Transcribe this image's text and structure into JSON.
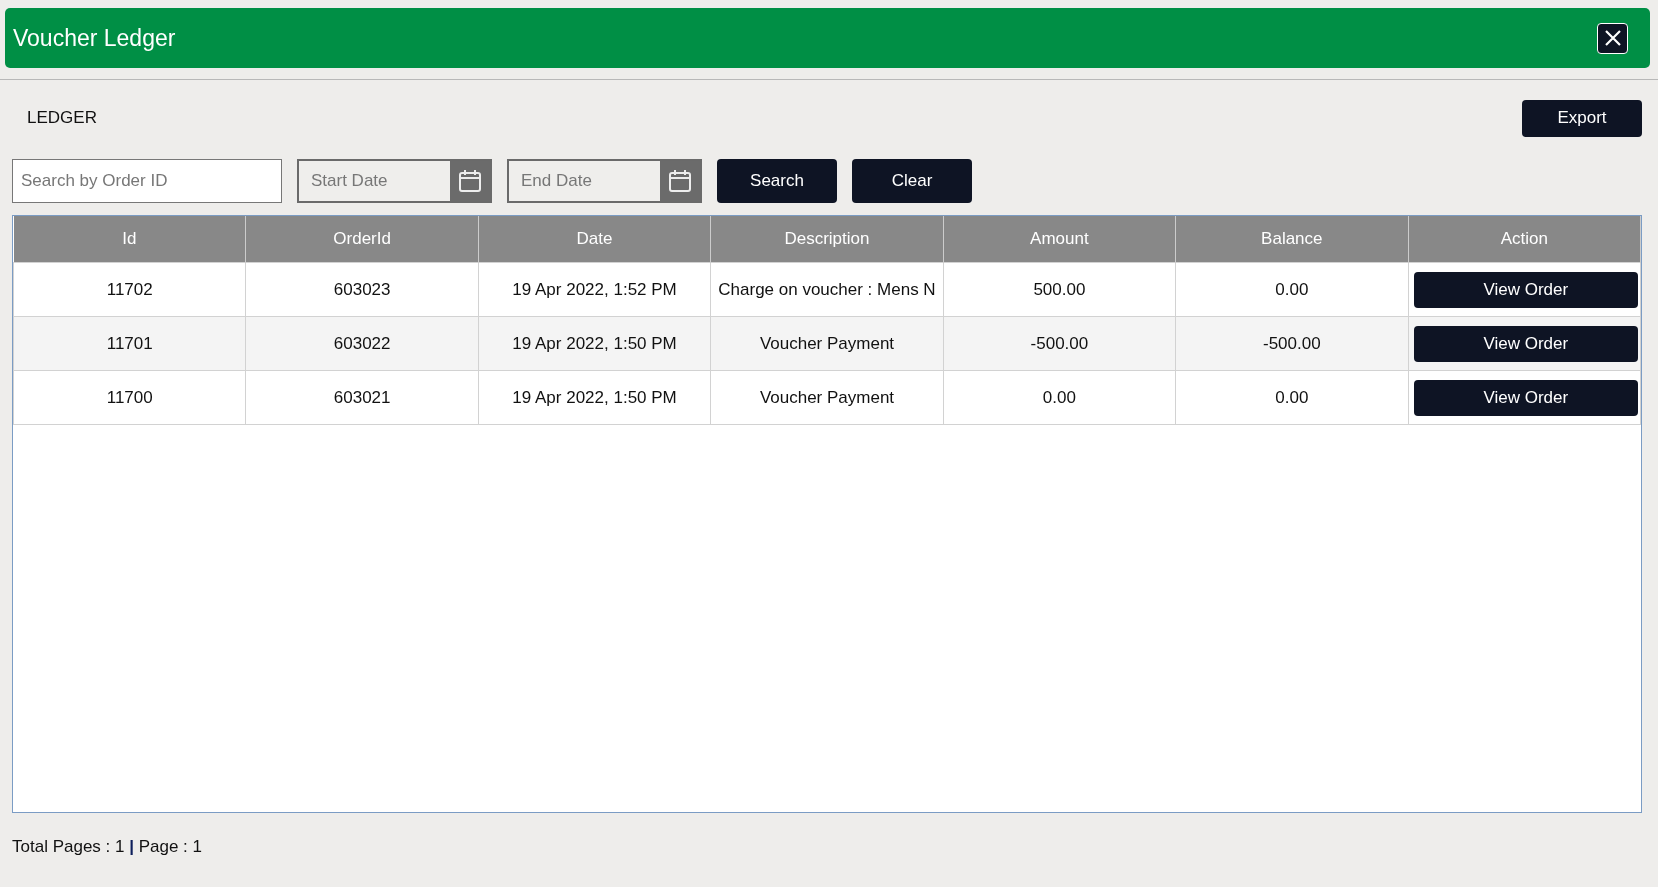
{
  "window": {
    "title": "Voucher Ledger"
  },
  "section_label": "LEDGER",
  "export_button": "Export",
  "filters": {
    "order_search": {
      "placeholder": "Search by Order ID"
    },
    "start_date": {
      "placeholder": "Start Date"
    },
    "end_date": {
      "placeholder": "End Date"
    },
    "buttons": [
      "Search",
      "Clear"
    ]
  },
  "table": {
    "columns": [
      "Id",
      "OrderId",
      "Date",
      "Description",
      "Amount",
      "Balance",
      "Action"
    ],
    "rows": [
      {
        "id": "11702",
        "order_id": "603023",
        "date": "19 Apr 2022, 1:52 PM",
        "description": "Charge on voucher : Mens N",
        "amount": "500.00",
        "balance": "0.00",
        "action": "View Order"
      },
      {
        "id": "11701",
        "order_id": "603022",
        "date": "19 Apr 2022, 1:50 PM",
        "description": "Voucher Payment",
        "amount": "-500.00",
        "balance": "-500.00",
        "action": "View Order"
      },
      {
        "id": "11700",
        "order_id": "603021",
        "date": "19 Apr 2022, 1:50 PM",
        "description": "Voucher Payment",
        "amount": "0.00",
        "balance": "0.00",
        "action": "View Order"
      }
    ]
  },
  "status_bar": "Total Pages : 1 **|** Page : 1"
}
